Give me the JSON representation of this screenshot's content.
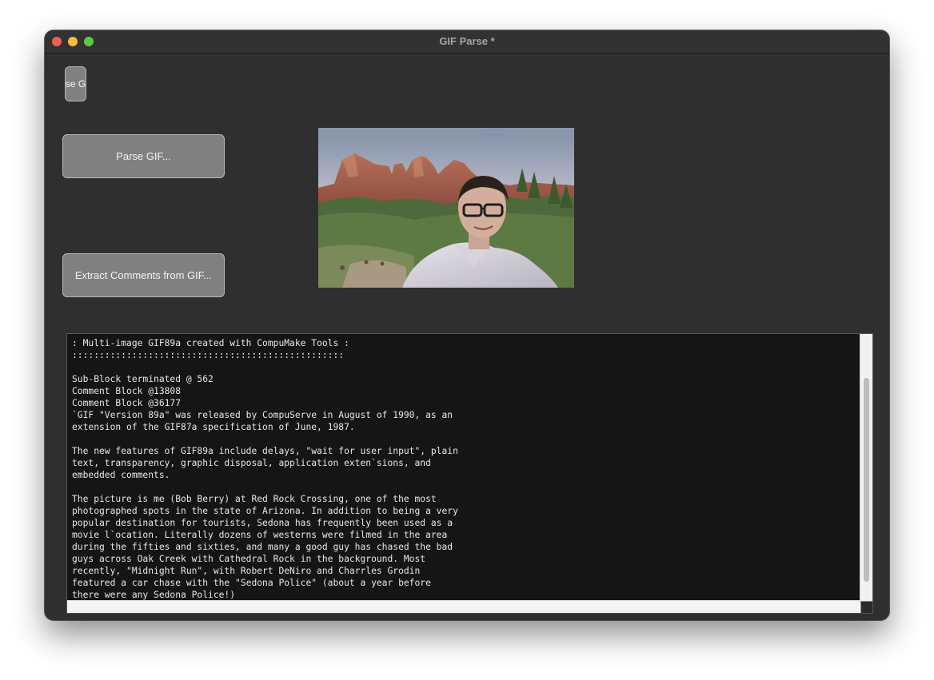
{
  "window": {
    "title": "GIF Parse *"
  },
  "buttons": {
    "small_label": "se G",
    "parse_label": "Parse GIF...",
    "extract_label": "Extract Comments from GIF..."
  },
  "preview": {
    "description_icon": "photo"
  },
  "output": {
    "text": ": Multi-image GIF89a created with CompuMake Tools :\n::::::::::::::::::::::::::::::::::::::::::::::::::\n\nSub-Block terminated @ 562\nComment Block @13808\nComment Block @36177\n`GIF \"Version 89a\" was released by CompuServe in August of 1990, as an\nextension of the GIF87a specification of June, 1987.\n\nThe new features of GIF89a include delays, \"wait for user input\", plain\ntext, transparency, graphic disposal, application exten`sions, and\nembedded comments.\n\nThe picture is me (Bob Berry) at Red Rock Crossing, one of the most\nphotographed spots in the state of Arizona. In addition to being a very\npopular destination for tourists, Sedona has frequently been used as a\nmovie l`ocation. Literally dozens of westerns were filmed in the area\nduring the fifties and sixties, and many a good guy has chased the bad\nguys across Oak Creek with Cathedral Rock in the background. Most\nrecently, \"Midnight Run\", with Robert DeNiro and Charrles Grodin\nfeatured a car chase with the \"Sedona Police\" (about a year before\nthere were any Sedona Police!)"
  },
  "colors": {
    "window_bg": "#2f2f2f",
    "button_bg": "#808080",
    "text_bg": "#151515",
    "close": "#ee5f57",
    "minimize": "#f6bd3b",
    "maximize": "#5ec843"
  }
}
